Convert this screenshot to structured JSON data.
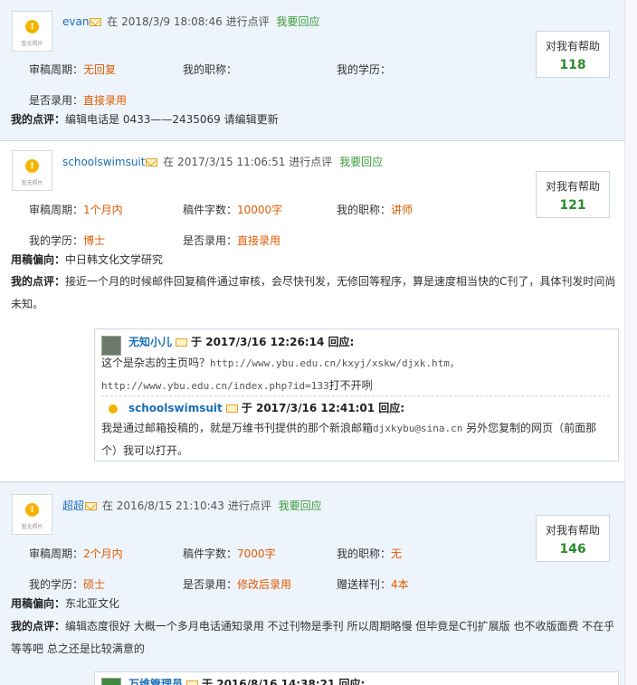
{
  "help_label": "对我有帮助",
  "reply_label": "我要回应",
  "avatar_caption": "暂无照片",
  "in_label": "在",
  "comment_verb": "进行点评",
  "at_label": "于",
  "reply_verb": "回应:",
  "reviews": [
    {
      "user": "evan",
      "datetime": "2018/3/9 18:08:46",
      "help_count": "118",
      "fields": [
        {
          "k": "审稿周期：",
          "v": "无回复"
        },
        {
          "k": "我的职称：",
          "v": ""
        },
        {
          "k": "我的学历：",
          "v": ""
        },
        {
          "k": "是否录用：",
          "v": "直接录用"
        }
      ],
      "comment_label": "我的点评：",
      "comment": "编辑电话是 0433——2435069 请编辑更新"
    },
    {
      "user": "schoolswimsuit",
      "datetime": "2017/3/15 11:06:51",
      "help_count": "121",
      "fields": [
        {
          "k": "审稿周期：",
          "v": "1个月内"
        },
        {
          "k": "稿件字数：",
          "v": "10000字"
        },
        {
          "k": "我的职称：",
          "v": "讲师"
        },
        {
          "k": "我的学历：",
          "v": "博士"
        },
        {
          "k": "是否录用：",
          "v": "直接录用"
        }
      ],
      "bias_label": "用稿偏向：",
      "bias": "中日韩文化文学研究",
      "comment_label": "我的点评：",
      "comment": "接近一个月的时候邮件回复稿件通过审核，会尽快刊发，无修回等程序，算是速度相当快的C刊了，具体刊发时间尚未知。",
      "thread": [
        {
          "name": "无知小儿",
          "datetime": "2017/3/16 12:26:14",
          "text1": "这个是杂志的主页吗？",
          "url1": "http://www.ybu.edu.cn/kxyj/xskw/djxk.htm，",
          "url2": "http://www.ybu.edu.cn/index.php?id=133",
          "text2": "打不开咧"
        },
        {
          "name": "schoolswimsuit",
          "datetime": "2017/3/16 12:41:01",
          "text1": "我是通过邮箱投稿的，就是万维书刊提供的那个新浪邮箱",
          "email": "djxkybu@sina.cn",
          "text2": " 另外您复制的网页（前面那",
          "text3": "个）我可以打开。"
        }
      ]
    },
    {
      "user": "超超",
      "datetime": "2016/8/15 21:10:43",
      "help_count": "146",
      "fields": [
        {
          "k": "审稿周期：",
          "v": "2个月内"
        },
        {
          "k": "稿件字数：",
          "v": "7000字"
        },
        {
          "k": "我的职称：",
          "v": "无"
        },
        {
          "k": "我的学历：",
          "v": "硕士"
        },
        {
          "k": "是否录用：",
          "v": "修改后录用"
        },
        {
          "k": "赠送样刊：",
          "v": "4本"
        }
      ],
      "bias_label": "用稿偏向：",
      "bias": "东北亚文化",
      "comment_label": "我的点评：",
      "comment": "编辑态度很好 大概一个多月电话通知录用 不过刊物是季刊 所以周期略慢 但毕竟是C刊扩展版 也不收版面费 不在乎等等吧 总之还是比较满意的",
      "thread_peek": {
        "name": "万维管理员",
        "datetime": "2016/8/16 14:38:21"
      }
    }
  ]
}
